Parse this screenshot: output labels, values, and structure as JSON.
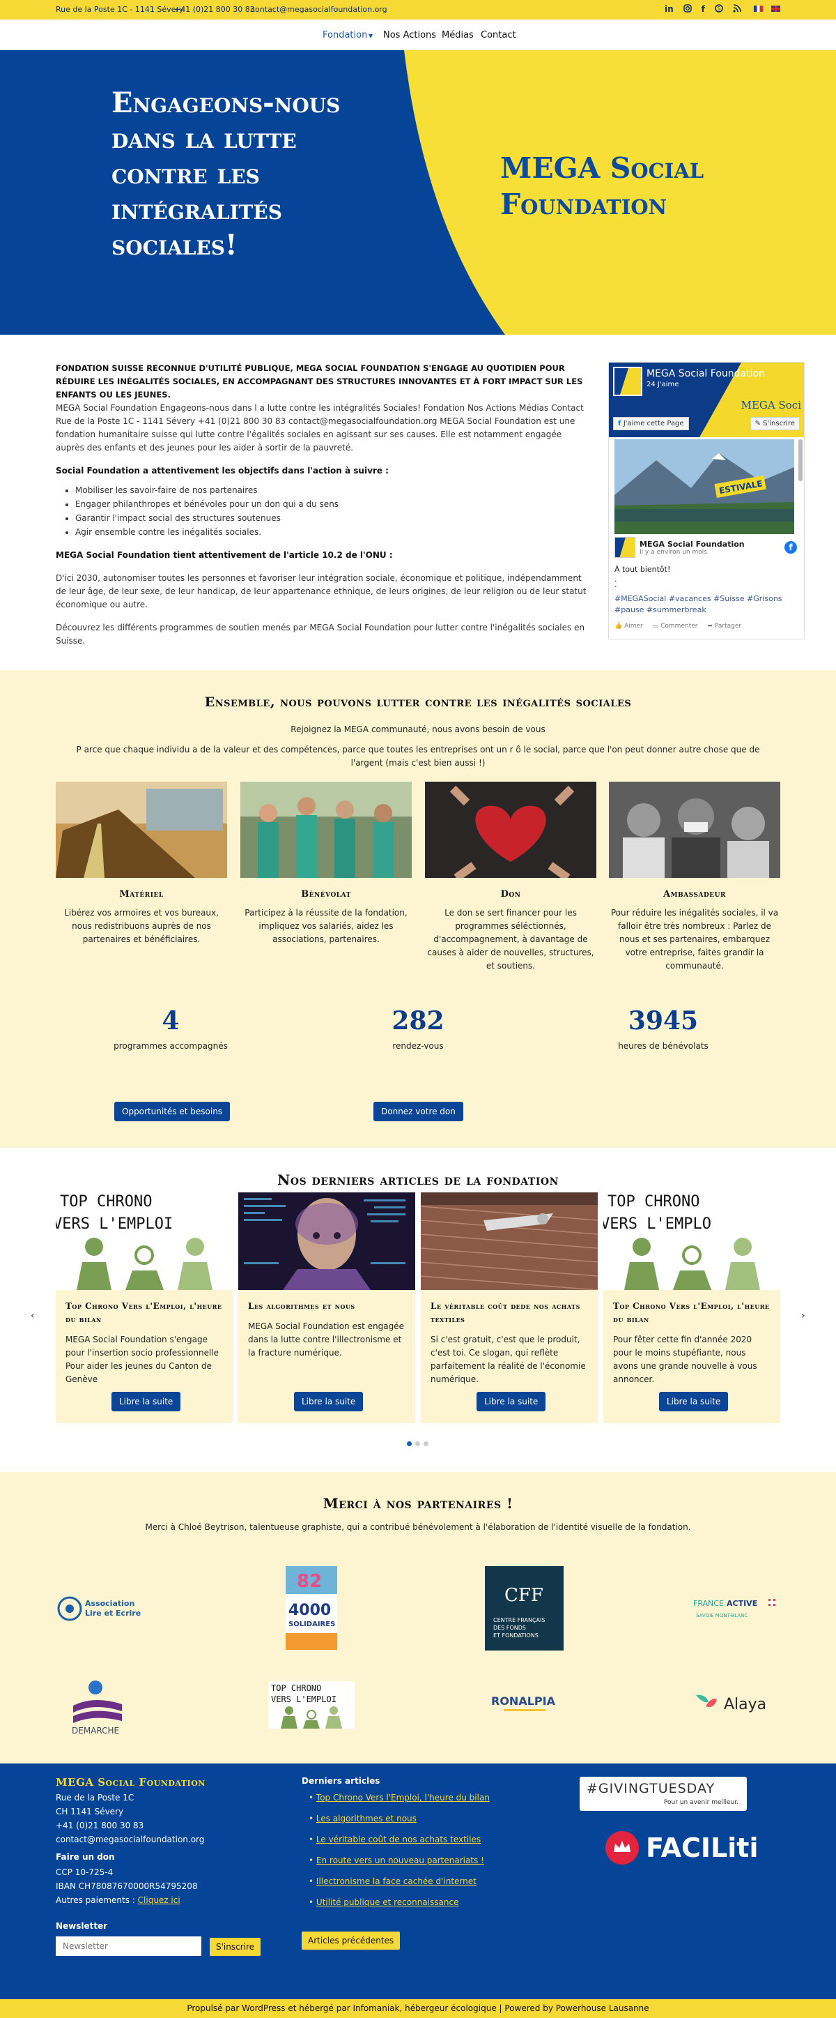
{
  "topbar": {
    "address": "Rue de la Poste 1C - 1141 Sévery",
    "phone": "+41 (0)21 800 30 83",
    "email": "contact@megasocialfoundation.org"
  },
  "nav": {
    "items": [
      "Fondation",
      "Nos Actions",
      "Médias",
      "Contact"
    ]
  },
  "hero": {
    "headline": "Engageons-nous dans la lutte contre les intégralités sociales!",
    "brand": "MEGA Social Foundation"
  },
  "intro": {
    "lead": "Fondation suisse reconnue d'utilité publique, MEGA Social Foundation s'engage au quotidien pour réduire les inégalités sociales, en accompagnant des structures innovantes et à fort impact sur les enfants ou les jeunes.",
    "p1": "MEGA Social Foundation Engageons-nous dans l a lutte contre les intégralités Sociales! Fondation Nos Actions Médias Contact Rue de la Poste 1C - 1141 Sévery +41 (0)21 800 30 83 contact@megasocialfoundation.org MEGA Social Foundation est une fondation humanitaire suisse qui lutte contre l'égalités sociales en agissant sur ses causes. Elle est notamment engagée auprès des enfants et des jeunes pour les aider à sortir de la pauvreté.",
    "objectives_title": "Social Foundation a attentivement les objectifs dans l'action à suivre :",
    "objectives": [
      "Mobiliser les savoir-faire de nos partenaires",
      "Engager philanthropes et bénévoles pour un don qui a du sens",
      "Garantir l'impact social des structures soutenues",
      "Agir ensemble contre les inégalités sociales."
    ],
    "onu_title": "MEGA Social Foundation tient attentivement de l'article 10.2 de l'ONU :",
    "onu_text": "D'ici 2030, autonomiser toutes les personnes et favoriser leur intégration sociale, économique et politique, indépendamment de leur âge, de leur sexe, de leur handicap, de leur appartenance ethnique, de leurs origines, de leur religion ou de leur statut économique ou autre.",
    "outro": "Découvrez les différents programmes de soutien menés par MEGA Social Foundation pour lutter contre l'inégalités sociales en Suisse."
  },
  "facebook": {
    "page_name": "MEGA Social Foundation",
    "likes": "24 J'aime",
    "like_button": "J'aime cette Page",
    "follow_button": "S'inscrire",
    "cover_text": "MEGA Soci",
    "img_text": "ESTIVALE",
    "post_author": "MEGA Social Foundation",
    "post_time": "Il y a environ un mois",
    "post_text": "À tout bientôt!",
    "post_tags": "#MEGASocial #vacances #Suisse #Grisons #pause #summerbreak",
    "actions": [
      "Aimer",
      "Commenter",
      "Partager"
    ],
    "icon_color": "#1877f2"
  },
  "ensemble": {
    "title": "Ensemble, nous pouvons lutter contre les inégalités sociales",
    "subtitle": "Rejoignez la MEGA communauté, nous avons besoin de vous",
    "text": "P arce que chaque individu a de la valeur et des compétences, parce que toutes les entreprises ont un r ô le social, parce que l'on peut donner autre chose que de l'argent (mais c'est bien aussi !)",
    "cards": [
      {
        "title": "Matériel",
        "text": "Libérez vos armoires et vos bureaux, nous redistribuons auprès de nos partenaires et bénéficiaires."
      },
      {
        "title": "Bénévolat",
        "text": "Participez à la réussite de la fondation, impliquez vos salariés, aidez les associations, partenaires."
      },
      {
        "title": "Don",
        "text": "Le don se sert financer pour les programmes séléctionnés, d'accompagnement, à davantage de causes à aider de nouvelles, structures, et soutiens."
      },
      {
        "title": "Ambassadeur",
        "text": "Pour réduire les inégalités sociales, il va falloir être très nombreux : Parlez de nous et ses partenaires, embarquez votre entreprise, faites grandir la communauté."
      }
    ],
    "stats": [
      {
        "value": "4",
        "label": "programmes accompagnés"
      },
      {
        "value": "282",
        "label": "rendez-vous"
      },
      {
        "value": "3945",
        "label": "heures de bénévolats"
      }
    ],
    "btn_opportunities": "Opportunités et besoins",
    "btn_donate": "Donnez votre don"
  },
  "articles": {
    "title": "Nos derniers articles de la fondation",
    "items": [
      {
        "title": "Top Chrono Vers l'Emploi, l'heure du bilan",
        "text": "MEGA Social Foundation s'engage pour l'insertion socio professionnelle Pour aider les jeunes du Canton de Genève",
        "button": "Libre la suite",
        "img_line1": "TOP CHRONO",
        "img_line2": "VERS L'EMPLOI"
      },
      {
        "title": "Les algorithmes et nous",
        "text": "MEGA Social Foundation est engagée dans la lutte contre l'illectronisme et la fracture numérique.",
        "button": "Libre la suite"
      },
      {
        "title": "Le véritable coût dede nos achats textiles",
        "text": "Si c'est gratuit, c'est que le produit, c'est toi. Ce slogan, qui reflète parfaitement la réalité de l'économie numérique.",
        "button": "Libre la suite"
      },
      {
        "title": "Top Chrono Vers l'Emploi, l'heure du bilan",
        "text": "Pour fêter cette fin d'année 2020 pour le moins stupéfiante, nous avons une grande nouvelle à vous annoncer.",
        "button": "Libre la suite",
        "img_line1": "TOP CHRONO",
        "img_line2": "VERS L'EMPLO"
      }
    ],
    "prev": "‹",
    "next": "›"
  },
  "partners": {
    "title": "Merci à nos partenaires !",
    "subtitle": "Merci à Chloé Beytrison, talentueuse graphiste, qui a contribué bénévolement à l'élaboration de l'identité visuelle de la fondation.",
    "logos": {
      "lire_ecrire": [
        "Association",
        "Lire et Ecrire"
      ],
      "solidaires": [
        "82",
        "4000",
        "SOLIDAIRES"
      ],
      "cff": [
        "CFF",
        "CENTRE FRANÇAIS",
        "DES FONDS",
        "ET FONDATIONS"
      ],
      "france_active": [
        "FRANCE",
        "ACTIVE",
        "SAVOIE MONT-BLANC"
      ],
      "demarche": "DEMARCHE",
      "top_chrono": [
        "TOP CHRONO",
        "VERS L'EMPLOI"
      ],
      "ronalpia": "RONALPIA",
      "alaya": "Alaya"
    }
  },
  "footer": {
    "brand": "MEGA Social Foundation",
    "address1": "Rue de la Poste 1C",
    "address2": "CH 1141 Sévery",
    "phone": "+41 (0)21 800 30 83",
    "email": "contact@megasocialfoundation.org",
    "don_title": "Faire un don",
    "ccp": "CCP 10-725-4",
    "iban": "IBAN CH78087670000R54795208",
    "other_pay": "Autres paiements :",
    "click_here": "Cliquez ici",
    "newsletter_title": "Newsletter",
    "newsletter_placeholder": "Newsletter",
    "subscribe": "S'inscrire",
    "latest_title": "Derniers articles",
    "latest": [
      "Top Chrono Vers l'Emploi, l'heure du bilan",
      "Les algorithmes et nous",
      "Le véritable coût de nos achats textiles",
      "En route vers un nouveau partenariats !",
      "Illectronisme la face cachée d'internet",
      "Utilité publique et reconnaissance"
    ],
    "previous_articles": "Articles précédentes",
    "giving": "#GIVINGTUESDAY",
    "giving_sub": "Pour un avenir meilleur.",
    "faciliti": "FACILiti",
    "bottom": "Propulsé par WordPress et hébergé par Infomaniak, hébergeur écologique | Powered by Powerhouse Lausanne"
  },
  "colors": {
    "blue": "#064497",
    "yellow": "#f7d936",
    "cream": "#fdf5d2"
  }
}
